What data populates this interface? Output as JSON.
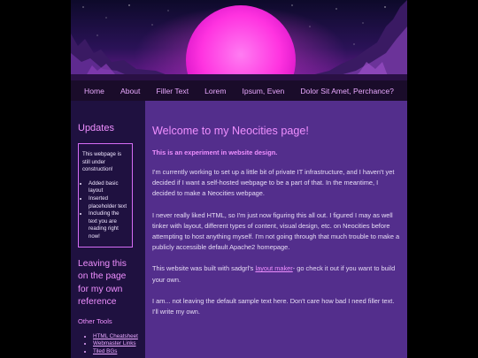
{
  "nav": {
    "items": [
      "Home",
      "About",
      "Filler Text",
      "Lorem",
      "Ipsum, Even",
      "Dolor Sit Amet, Perchance?"
    ]
  },
  "sidebar": {
    "title": "Updates",
    "notice_text": "This webpage is still under construction!",
    "notice_items": [
      "Added basic layout",
      "Inserted placeholder text",
      "Including the text you are reading right now!"
    ],
    "reference_heading": "Leaving this on the page for my own reference",
    "other_tools_heading": "Other Tools",
    "tool_links": [
      "HTML Cheatsheet",
      "Webmaster Links",
      "Tiled BGs"
    ]
  },
  "main": {
    "title": "Welcome to my Neocities page!",
    "subtitle": "This is an experiment in website design.",
    "para1": "I'm currently working to set up a little bit of private IT infrastructure, and I haven't yet decided if I want a self-hosted webpage to be a part of that. In the meantime, I decided to make a Neocities webpage.",
    "para2": "I never really liked HTML, so I'm just now figuring this all out. I figured I may as well tinker with layout, different types of content, visual design, etc. on Neocities before attempting to host anything myself. I'm not going through that much trouble to make a publicly accessible default Apache2 homepage.",
    "para3_before": "This website was built with sadgrl's",
    "para3_link": "layout maker",
    "para3_after": "- go check it out if you want to build your own.",
    "para4": "I am... not leaving the default sample text here. Don't care how bad I need filler text. I'll write my own."
  },
  "colors": {
    "page_bg": "#000000",
    "nav_bg": "#1a0c2a",
    "sidebar_bg": "#1f1140",
    "main_bg": "#532e8c",
    "accent": "#ef8fff",
    "sun": "#ff3de0"
  }
}
